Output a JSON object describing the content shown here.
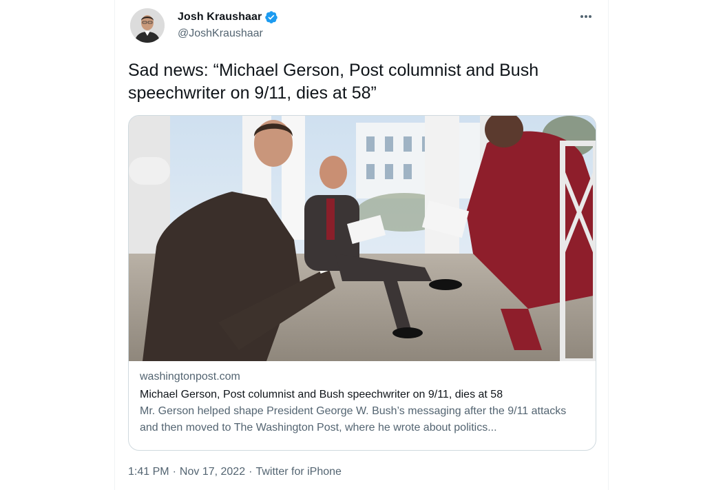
{
  "author": {
    "display_name": "Josh Kraushaar",
    "handle": "@JoshKraushaar",
    "verified": true,
    "avatar_icon": "person-avatar",
    "verified_icon": "verified-badge-icon"
  },
  "more_icon": "ellipsis-icon",
  "tweet": {
    "text": "Sad news: “Michael Gerson, Post columnist and Bush speechwriter on 9/11, dies at 58”"
  },
  "link_card": {
    "image_alt_icon": "photo-oval-office-meeting",
    "domain": "washingtonpost.com",
    "title": "Michael Gerson, Post columnist and Bush speechwriter on 9/11, dies at 58",
    "description": "Mr. Gerson helped shape President George W. Bush’s messaging after the 9/11 attacks and then moved to The Washington Post, where he wrote about politics..."
  },
  "meta": {
    "time": "1:41 PM",
    "separator": "·",
    "date": "Nov 17, 2022",
    "source": "Twitter for iPhone"
  },
  "colors": {
    "text_primary": "#0f1419",
    "text_secondary": "#536471",
    "verified_blue": "#1d9bf0",
    "border": "#cfd9de"
  }
}
